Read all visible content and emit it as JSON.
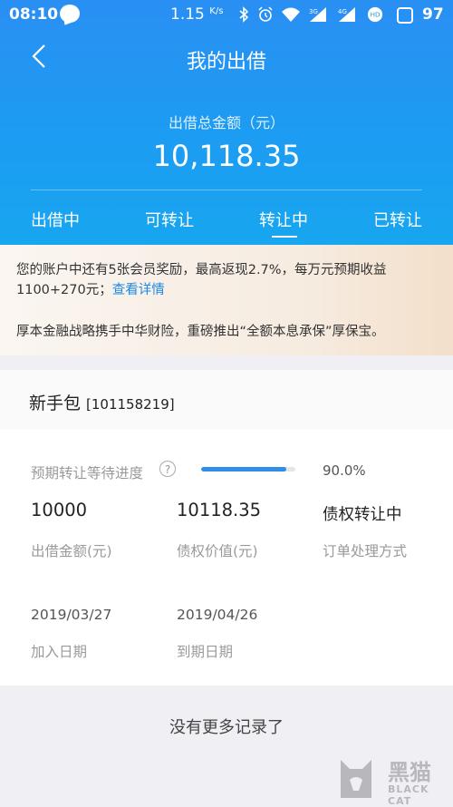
{
  "status_bar": {
    "time": "08:10",
    "speed": "1.15",
    "speed_unit": "K/s",
    "net1": "3G",
    "net2": "4G",
    "badge": "HD",
    "battery": "97"
  },
  "header": {
    "title": "我的出借",
    "total_label": "出借总金额（元）",
    "total_value": "10,118.35"
  },
  "tabs": [
    {
      "label": "出借中"
    },
    {
      "label": "可转让"
    },
    {
      "label": "转让中",
      "active": true
    },
    {
      "label": "已转让"
    }
  ],
  "notice": {
    "line1": "您的账户中还有5张会员奖励，最高返现2.7%，每万元预期收益1100+270元；",
    "link": "查看详情",
    "line2": "厚本金融战略携手中华财险，重磅推出“全额本息承保”厚保宝。"
  },
  "item": {
    "name": "新手包",
    "code": "[101158219]",
    "progress_label": "预期转让等待进度",
    "progress_value": 0.9,
    "progress_text": "90.0%",
    "amount": "10000",
    "amount_label": "出借金额(元)",
    "claim_value": "10118.35",
    "claim_label": "债权价值(元)",
    "method": "债权转让中",
    "method_label": "订单处理方式",
    "join_date": "2019/03/27",
    "join_label": "加入日期",
    "due_date": "2019/04/26",
    "due_label": "到期日期"
  },
  "footer": {
    "no_more": "没有更多记录了"
  },
  "watermark": {
    "cn": "黑猫",
    "en": "BLACK CAT"
  },
  "colors": {
    "header_blue": "#1c9cf2",
    "link_blue": "#1a88e8",
    "progress_blue": "#2f8fe8"
  }
}
